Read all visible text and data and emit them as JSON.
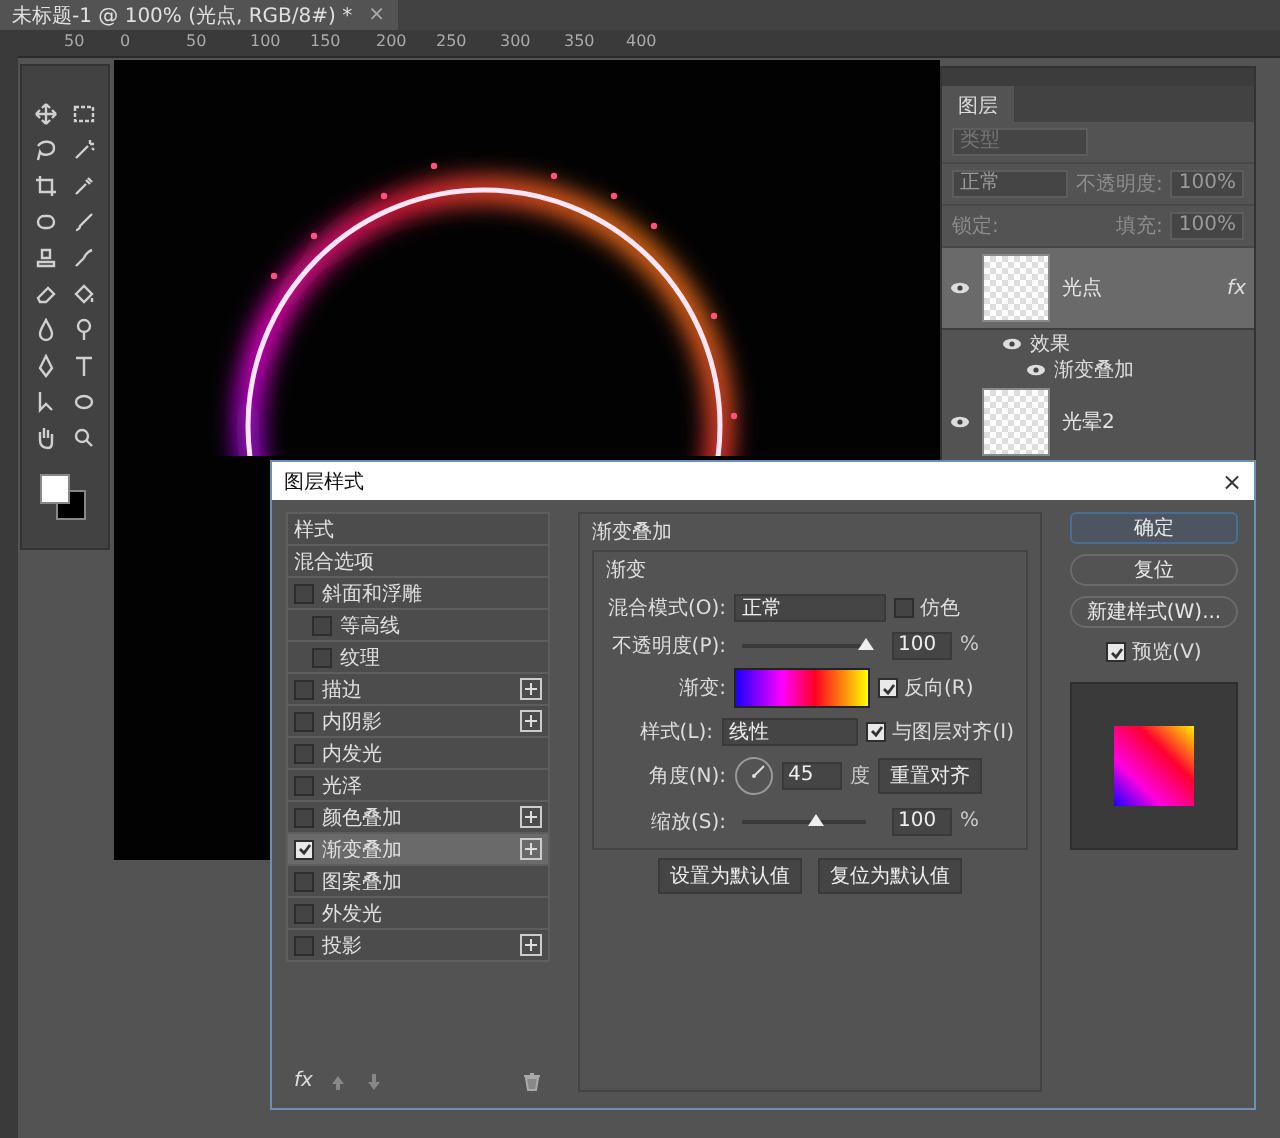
{
  "document_tab": {
    "title": "未标题-1 @ 100% (光点, RGB/8#) *",
    "close": "×"
  },
  "ruler": {
    "labels": [
      "50",
      "0",
      "50",
      "100",
      "150",
      "200",
      "250",
      "300",
      "350",
      "400"
    ]
  },
  "layers_panel": {
    "tab": "图层",
    "search_placeholder": "类型",
    "blend_mode": "正常",
    "opacity_label": "不透明度:",
    "opacity": "100%",
    "lock_label": "锁定:",
    "fill_label": "填充:",
    "fill": "100%",
    "layers": [
      {
        "name": "光点",
        "selected": true,
        "fx": "fx",
        "effects_label": "效果",
        "effects": [
          "渐变叠加"
        ]
      },
      {
        "name": "光晕2",
        "selected": false
      }
    ]
  },
  "dialog": {
    "title": "图层样式",
    "close": "×",
    "fx_label": "fx",
    "styles": [
      {
        "kind": "header",
        "label": "样式",
        "selected": false
      },
      {
        "kind": "header",
        "label": "混合选项",
        "selected": false
      },
      {
        "kind": "check",
        "label": "斜面和浮雕",
        "checked": false,
        "selected": false,
        "plus": false,
        "children": [
          {
            "kind": "check",
            "label": "等高线",
            "checked": false,
            "selected": false,
            "plus": false
          },
          {
            "kind": "check",
            "label": "纹理",
            "checked": false,
            "selected": false,
            "plus": false
          }
        ]
      },
      {
        "kind": "check",
        "label": "描边",
        "checked": false,
        "selected": false,
        "plus": true
      },
      {
        "kind": "check",
        "label": "内阴影",
        "checked": false,
        "selected": false,
        "plus": true
      },
      {
        "kind": "check",
        "label": "内发光",
        "checked": false,
        "selected": false,
        "plus": false
      },
      {
        "kind": "check",
        "label": "光泽",
        "checked": false,
        "selected": false,
        "plus": false
      },
      {
        "kind": "check",
        "label": "颜色叠加",
        "checked": false,
        "selected": false,
        "plus": true
      },
      {
        "kind": "check",
        "label": "渐变叠加",
        "checked": true,
        "selected": true,
        "plus": true
      },
      {
        "kind": "check",
        "label": "图案叠加",
        "checked": false,
        "selected": false,
        "plus": false
      },
      {
        "kind": "check",
        "label": "外发光",
        "checked": false,
        "selected": false,
        "plus": false
      },
      {
        "kind": "check",
        "label": "投影",
        "checked": false,
        "selected": false,
        "plus": true
      }
    ],
    "section_title": "渐变叠加",
    "group_title": "渐变",
    "blend": {
      "label": "混合模式(O):",
      "value": "正常"
    },
    "dither": {
      "label": "仿色",
      "checked": false
    },
    "opacity": {
      "label": "不透明度(P):",
      "level": 1,
      "value": "100",
      "unit": "%"
    },
    "gradient": {
      "label": "渐变:"
    },
    "reverse": {
      "label": "反向(R)",
      "checked": true
    },
    "style": {
      "label": "样式(L):",
      "value": "线性"
    },
    "align": {
      "label": "与图层对齐(I)",
      "checked": true
    },
    "angle": {
      "label": "角度(N):",
      "value": "45",
      "unit": "度"
    },
    "reset_align": "重置对齐",
    "scale": {
      "label": "缩放(S):",
      "level": 0.6,
      "value": "100",
      "unit": "%"
    },
    "default_buttons": [
      "设置为默认值",
      "复位为默认值"
    ],
    "actions": [
      {
        "label": "确定",
        "selected": true
      },
      {
        "label": "复位",
        "selected": false
      },
      {
        "label": "新建样式(W)...",
        "selected": false
      }
    ],
    "preview": {
      "label": "预览(V)",
      "checked": true
    }
  }
}
